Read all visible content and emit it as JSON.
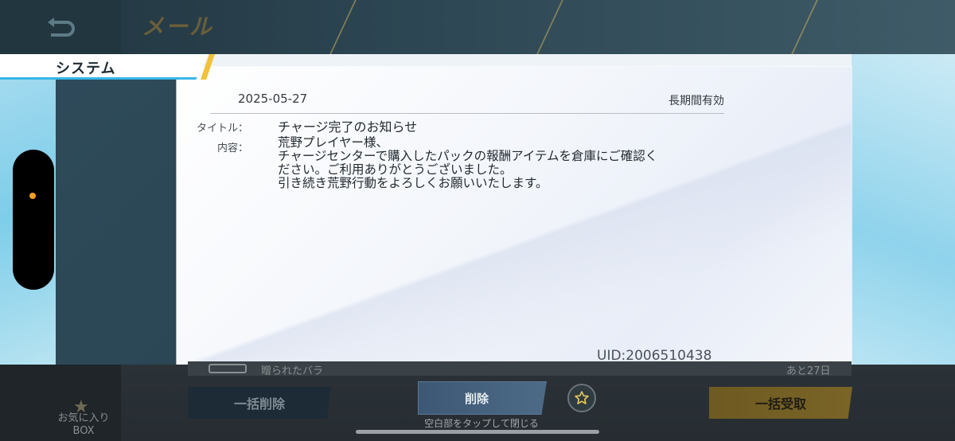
{
  "header": {
    "title": "メール",
    "back_icon": "return-arrow-icon"
  },
  "category_tab": {
    "label": "システム"
  },
  "mail": {
    "date": "2025-05-27",
    "validity": "長期間有効",
    "title_label": "タイトル：",
    "title": "チャージ完了のお知らせ",
    "content_label": "内容：",
    "body_lines": [
      "荒野プレイヤー様、",
      "チャージセンターで購入したパックの報酬アイテムを倉庫にご確認く",
      "ださい。ご利用ありがとうございました。",
      "引き続き荒野行動をよろしくお願いいたします。"
    ],
    "uid": "UID:2006510438"
  },
  "background_list": {
    "item_text": "贈られたバラ",
    "item_remaining": "あと27日"
  },
  "footer": {
    "favorites_label_line1": "お気に入り",
    "favorites_label_line2": "BOX",
    "delete_all_label": "一括削除",
    "delete_label": "削除",
    "claim_all_label": "一括受取",
    "tap_hint": "空白部をタップして閉じる"
  },
  "colors": {
    "accent_blue": "#39b6e6",
    "accent_gold": "#f2c23c",
    "indicator_orange": "#f5a01a"
  }
}
